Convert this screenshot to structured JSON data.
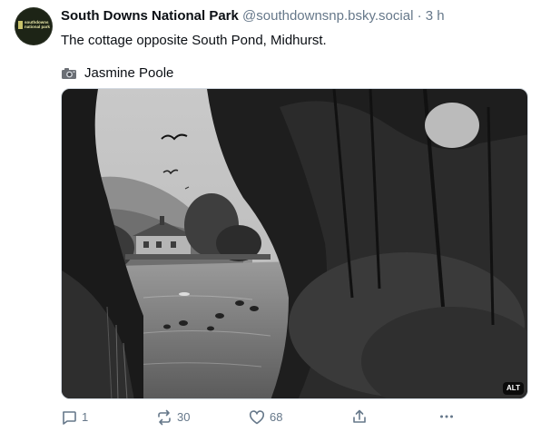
{
  "author": {
    "display_name": "South Downs National Park",
    "handle": "@southdownsnp.bsky.social",
    "separator": "·",
    "timestamp": "3 h",
    "avatar_text": "southdowns national park"
  },
  "post": {
    "text": "The cottage opposite South Pond, Midhurst.",
    "credit_icon": "camera-icon",
    "credit": "Jasmine Poole"
  },
  "image": {
    "alt_badge": "ALT",
    "style": "black-and-white photograph"
  },
  "actions": {
    "reply_icon": "speech-bubble-icon",
    "reply_count": "1",
    "repost_icon": "repost-arrows-icon",
    "repost_count": "30",
    "like_icon": "heart-icon",
    "like_count": "68",
    "share_icon": "share-arrow-icon",
    "more_icon": "ellipsis-icon"
  }
}
